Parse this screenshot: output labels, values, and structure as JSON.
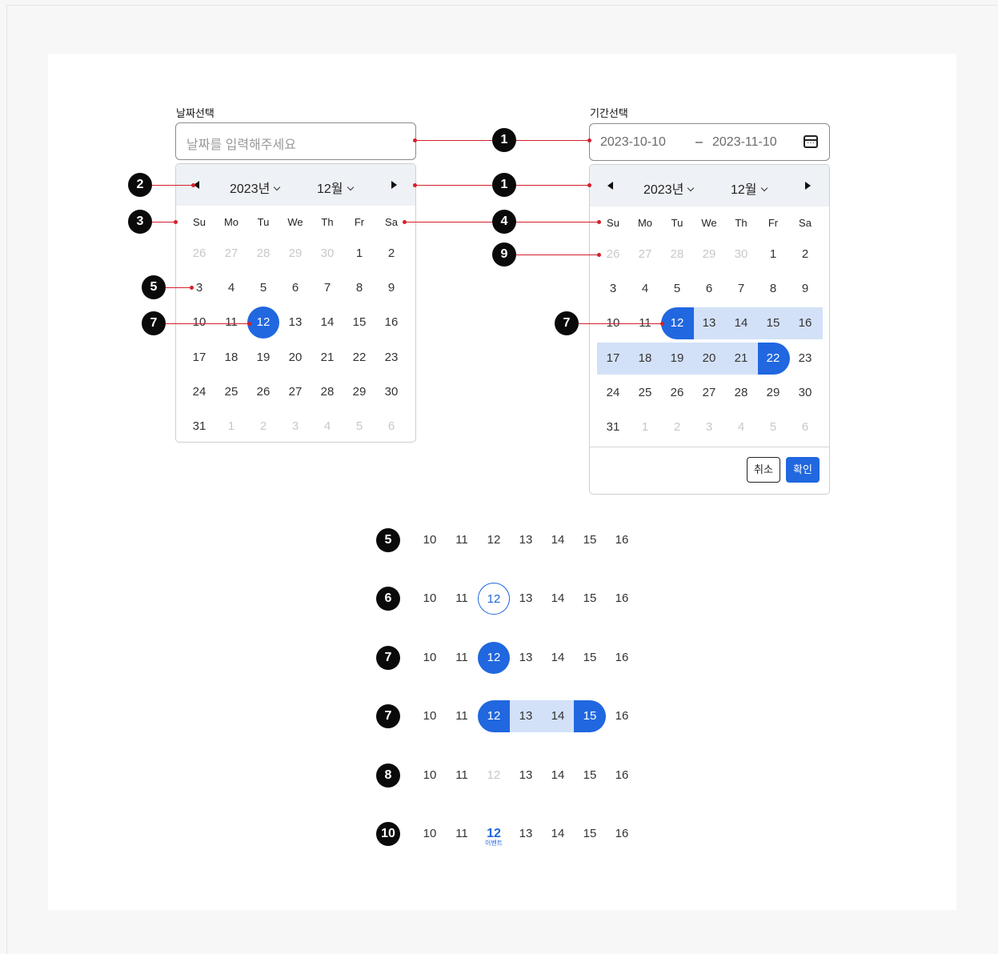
{
  "single": {
    "label": "날짜선택",
    "placeholder": "날짜를 입력해주세요",
    "year": "2023년",
    "month": "12월",
    "weekdays": [
      "Su",
      "Mo",
      "Tu",
      "We",
      "Th",
      "Fr",
      "Sa"
    ],
    "weeks": [
      [
        "26",
        "27",
        "28",
        "29",
        "30",
        "1",
        "2"
      ],
      [
        "3",
        "4",
        "5",
        "6",
        "7",
        "8",
        "9"
      ],
      [
        "10",
        "11",
        "12",
        "13",
        "14",
        "15",
        "16"
      ],
      [
        "17",
        "18",
        "19",
        "20",
        "21",
        "22",
        "23"
      ],
      [
        "24",
        "25",
        "26",
        "27",
        "28",
        "29",
        "30"
      ],
      [
        "31",
        "1",
        "2",
        "3",
        "4",
        "5",
        "6"
      ]
    ]
  },
  "range": {
    "label": "기간선택",
    "start": "2023-10-10",
    "separator": "–",
    "end": "2023-11-10",
    "year": "2023년",
    "month": "12월",
    "weekdays": [
      "Su",
      "Mo",
      "Tu",
      "We",
      "Th",
      "Fr",
      "Sa"
    ],
    "weeks": [
      [
        "26",
        "27",
        "28",
        "29",
        "30",
        "1",
        "2"
      ],
      [
        "3",
        "4",
        "5",
        "6",
        "7",
        "8",
        "9"
      ],
      [
        "10",
        "11",
        "12",
        "13",
        "14",
        "15",
        "16"
      ],
      [
        "17",
        "18",
        "19",
        "20",
        "21",
        "22",
        "23"
      ],
      [
        "24",
        "25",
        "26",
        "27",
        "28",
        "29",
        "30"
      ],
      [
        "31",
        "1",
        "2",
        "3",
        "4",
        "5",
        "6"
      ]
    ],
    "cancel": "취소",
    "confirm": "확인"
  },
  "badges": {
    "b1": "1",
    "b2": "2",
    "b3": "3",
    "b4": "4",
    "b5": "5",
    "b6": "6",
    "b7": "7",
    "b8": "8",
    "b9": "9",
    "b10": "10"
  },
  "legend_rows": {
    "days": [
      "10",
      "11",
      "12",
      "13",
      "14",
      "15",
      "16"
    ],
    "event_label": "이벤트"
  },
  "colors": {
    "accent": "#2067e0",
    "range_fill": "#d3e1f8",
    "marker_line": "#d61f2a"
  }
}
